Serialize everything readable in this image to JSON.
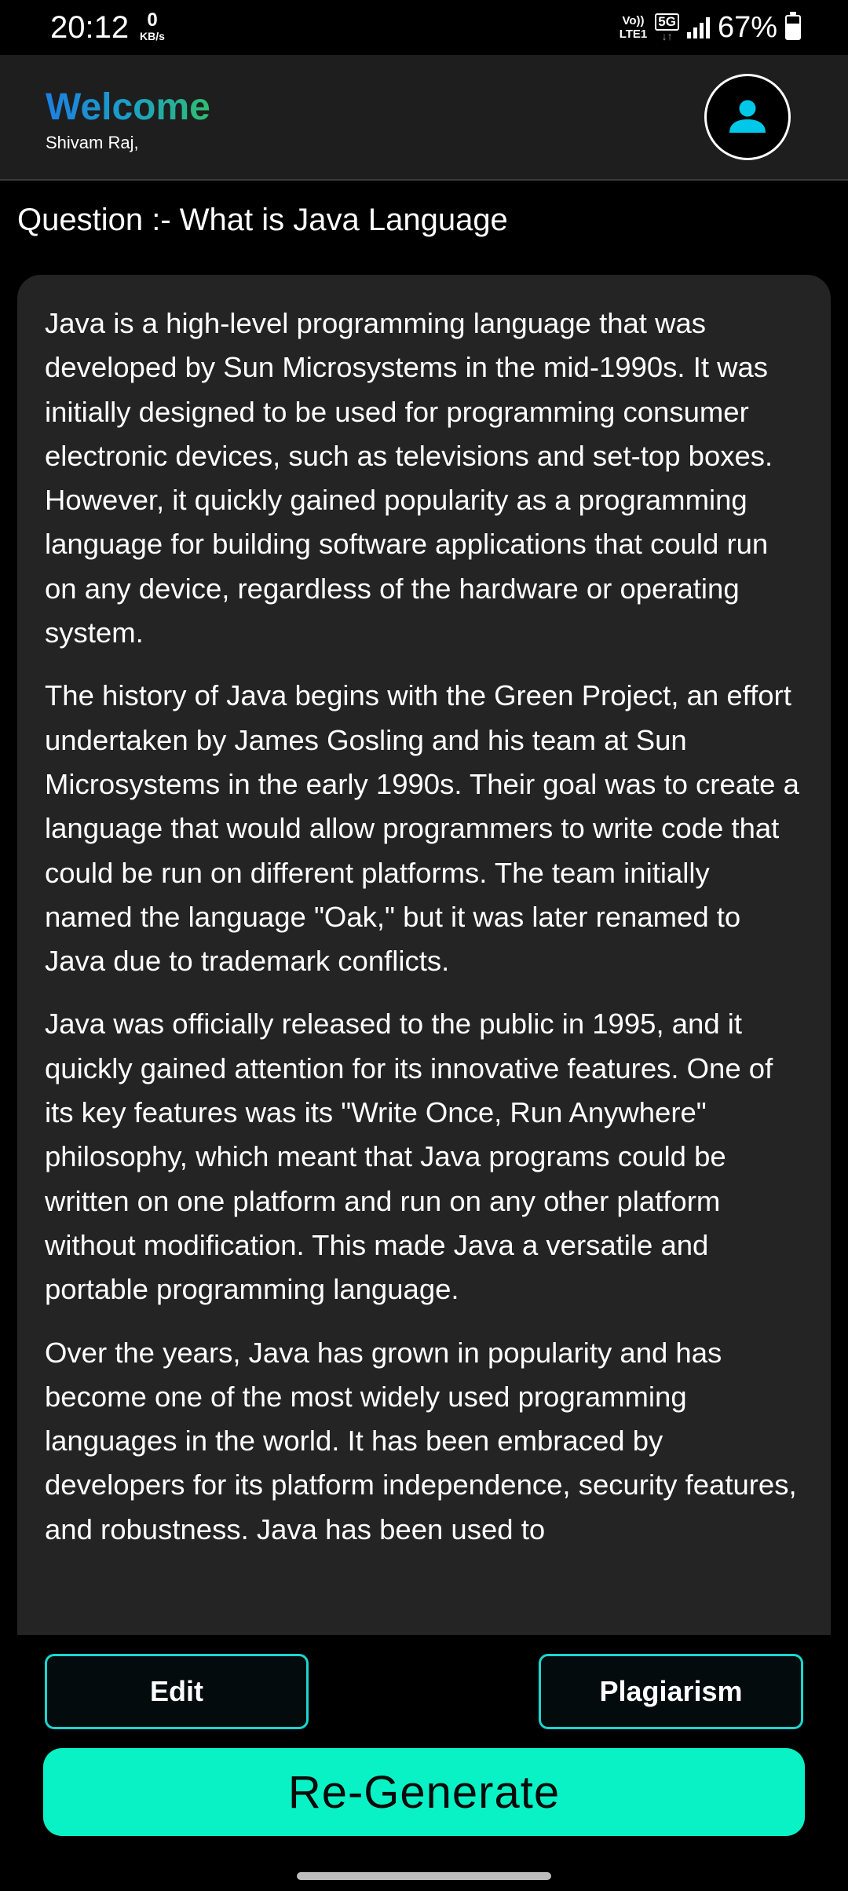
{
  "status_bar": {
    "time": "20:12",
    "net_speed_value": "0",
    "net_speed_unit": "KB/s",
    "volte_line1": "Vo))",
    "volte_line2": "LTE1",
    "network_badge": "5G",
    "network_arrows": "↓↑",
    "battery_percent": "67%",
    "battery_level": 0.67
  },
  "header": {
    "title": "Welcome",
    "username": "Shivam Raj,",
    "title_gradient": [
      "#1e7fe0",
      "#2fbf6f"
    ]
  },
  "question": {
    "text": "Question :- What is Java Language"
  },
  "answer": {
    "paragraphs": [
      "Java is a high-level programming language that was developed by Sun Microsystems in the mid-1990s. It was initially designed to be used for programming consumer electronic devices, such as televisions and set-top boxes. However, it quickly gained popularity as a programming language for building software applications that could run on any device, regardless of the hardware or operating system.",
      "The history of Java begins with the Green Project, an effort undertaken by James Gosling and his team at Sun Microsystems in the early 1990s. Their goal was to create a language that would allow programmers to write code that could be run on different platforms. The team initially named the language \"Oak,\" but it was later renamed to Java due to trademark conflicts.",
      "Java was officially released to the public in 1995, and it quickly gained attention for its innovative features. One of its key features was its \"Write Once, Run Anywhere\" philosophy, which meant that Java programs could be written on one platform and run on any other platform without modification. This made Java a versatile and portable programming language.",
      "Over the years, Java has grown in popularity and has become one of the most widely used programming languages in the world. It has been embraced by developers for its platform independence, security features, and robustness. Java has been used to"
    ]
  },
  "actions": {
    "edit_label": "Edit",
    "plagiarism_label": "Plagiarism",
    "regenerate_label": "Re-Generate"
  },
  "icons": {
    "avatar": "user-icon"
  },
  "colors": {
    "accent": "#08f2c6",
    "outline": "#19d6cf",
    "avatar_icon": "#00c8e8",
    "card_bg": "#242424",
    "header_bg": "#1e1e1e"
  }
}
